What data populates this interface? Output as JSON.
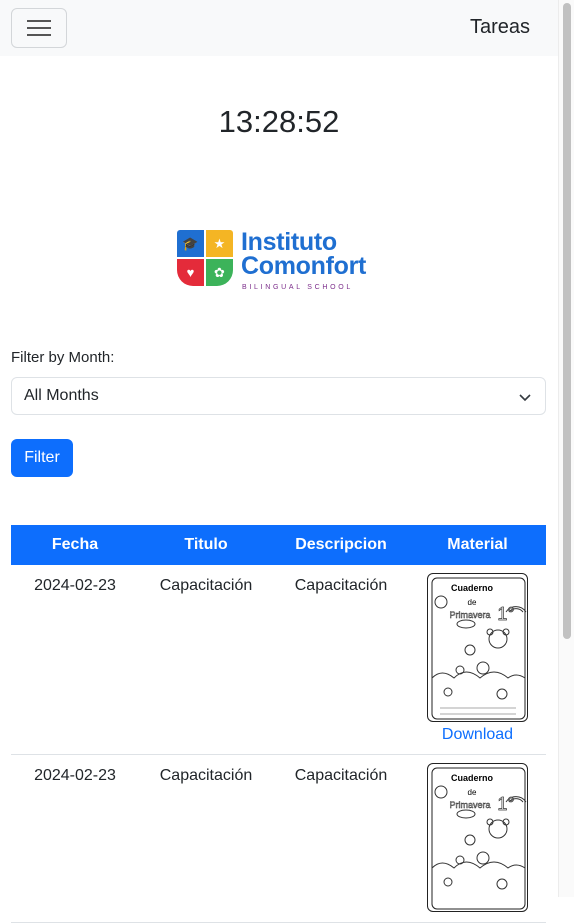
{
  "navbar": {
    "brand": "Tareas",
    "toggler_icon": "hamburger-icon"
  },
  "clock": "13:28:52",
  "logo": {
    "line1": "Instituto",
    "line2": "Comonfort",
    "tagline": "BILINGUAL SCHOOL"
  },
  "filter": {
    "label": "Filter by Month:",
    "selected": "All Months",
    "button_label": "Filter"
  },
  "table": {
    "headers": [
      "Fecha",
      "Titulo",
      "Descripcion",
      "Material"
    ],
    "rows": [
      {
        "fecha": "2024-02-23",
        "titulo": "Capacitación",
        "descripcion": "Capacitación",
        "material": {
          "cover_title_1": "Cuaderno",
          "cover_title_2": "de",
          "cover_title_3": "Primavera",
          "grade": "1°",
          "download_label": "Download"
        }
      },
      {
        "fecha": "2024-02-23",
        "titulo": "Capacitación",
        "descripcion": "Capacitación",
        "material": {
          "cover_title_1": "Cuaderno",
          "cover_title_2": "de",
          "cover_title_3": "Primavera",
          "grade": "1°"
        }
      }
    ]
  },
  "colors": {
    "primary": "#0d6efd",
    "navbar_bg": "#f8f9fa",
    "logo_blue": "#1f6fd1",
    "logo_yellow": "#f4b524",
    "logo_red": "#e42b3a",
    "logo_green": "#3cb35a"
  }
}
